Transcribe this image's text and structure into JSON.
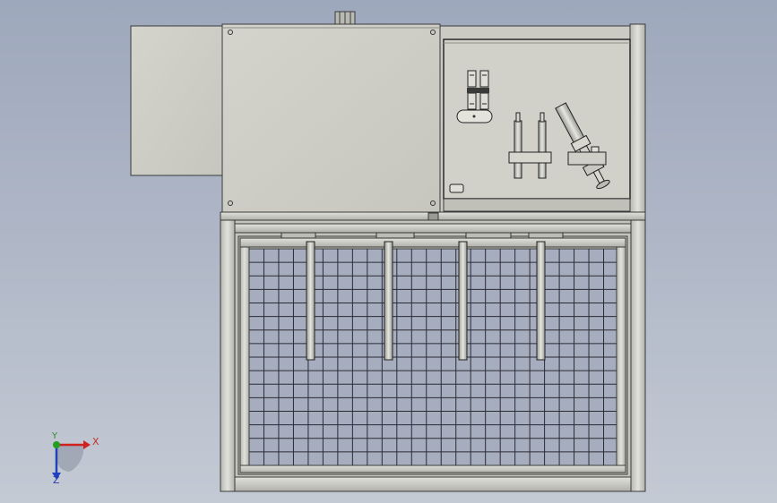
{
  "viewport": {
    "background_top": "#9ea8bc",
    "background_bottom": "#c4cad4"
  },
  "model": {
    "panel_color": "#cfcfc7",
    "frame_color": "#c8c8c4",
    "edge_color": "#3a3a3a",
    "mesh_line_color": "#2b2b34",
    "mesh_background": "#a6adbf",
    "tube_color": "#d4d4cc",
    "mesh_rows": 16,
    "mesh_cols": 25
  },
  "triad": {
    "x_label": "X",
    "y_label": "Y",
    "z_label": "Z",
    "x_color": "#d02020",
    "y_color": "#20a020",
    "z_color": "#2040c0"
  }
}
